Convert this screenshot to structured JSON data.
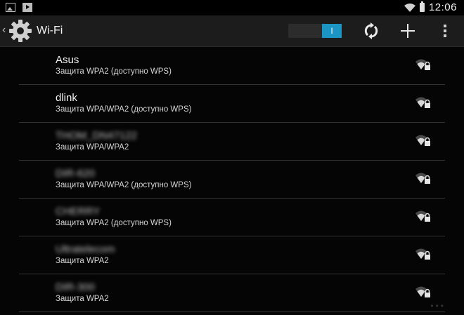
{
  "statusbar": {
    "time": "12:06",
    "left_icons": [
      "picture-icon",
      "play-store-icon"
    ]
  },
  "actionbar": {
    "title": "Wi-Fi",
    "toggle_label": "I",
    "back_icon": "chevron-left-icon",
    "settings_icon": "gear-icon",
    "refresh_icon": "refresh-icon",
    "add_icon": "add-icon",
    "more_icon": "overflow-menu-icon"
  },
  "networks": [
    {
      "name": "Asus",
      "security": "Защита WPA2 (доступно WPS)",
      "obscured": false
    },
    {
      "name": "dlink",
      "security": "Защита WPA/WPA2 (доступно WPS)",
      "obscured": false
    },
    {
      "name": "THOM_DN47122",
      "security": "Защита WPA/WPA2",
      "obscured": true
    },
    {
      "name": "DIR-620",
      "security": "Защита WPA/WPA2 (доступно WPS)",
      "obscured": true
    },
    {
      "name": "CHERRY",
      "security": "Защита WPA2 (доступно WPS)",
      "obscured": true
    },
    {
      "name": "Ultratelecom",
      "security": "Защита WPA2",
      "obscured": true
    },
    {
      "name": "DIR-300",
      "security": "Защита WPA2",
      "obscured": true
    }
  ],
  "colors": {
    "accent": "#1a95c4",
    "background": "#050505",
    "actionbar": "#1c1c1c"
  }
}
